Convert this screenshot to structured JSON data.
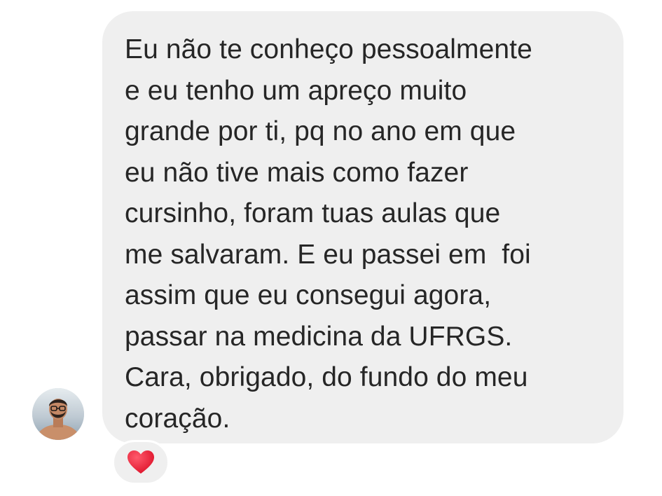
{
  "message": {
    "lines": [
      "Eu não te conheço pessoalmente",
      "e eu tenho um apreço muito",
      "grande por ti, pq no ano em que",
      "eu não tive mais como fazer",
      "cursinho, foram tuas aulas que",
      "me salvaram. E eu passei em  foi",
      "assim que eu consegui agora,",
      "passar na medicina da UFRGS.",
      "Cara, obrigado, do fundo do meu",
      "coração."
    ],
    "bubble_color": "#efefef",
    "text_color": "#262626"
  },
  "sender": {
    "avatar_icon": "avatar-photo-icon"
  },
  "reaction": {
    "icon": "heart-icon",
    "color": "#e8203a"
  }
}
